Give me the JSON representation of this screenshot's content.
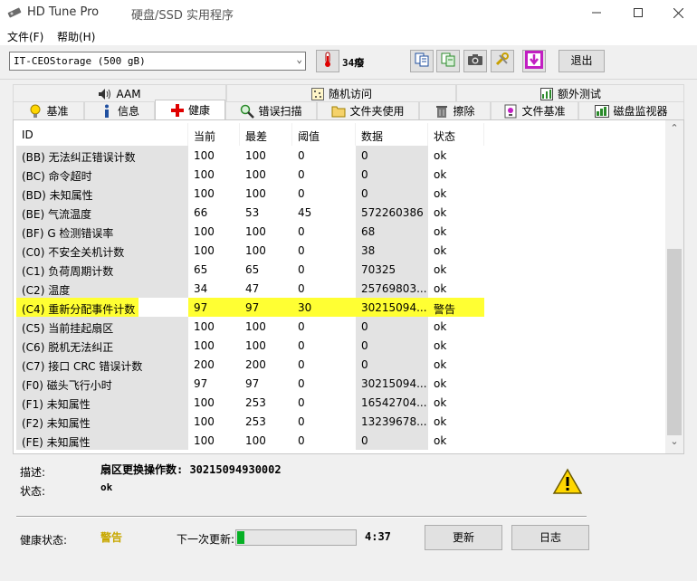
{
  "window": {
    "app_name": "HD Tune Pro",
    "subtitle": "硬盘/SSD 实用程序"
  },
  "menu": {
    "file": "文件(F)",
    "help": "帮助(H)"
  },
  "toolbar": {
    "drive": "IT-CEOStorage (500 gB)",
    "temperature": "34癈",
    "exit": "退出"
  },
  "tabs_row1": [
    {
      "label": "AAM",
      "icon": "speaker-icon"
    },
    {
      "label": "随机访问",
      "icon": "grid-icon"
    },
    {
      "label": "额外测试",
      "icon": "chart-icon"
    }
  ],
  "tabs_row2": [
    {
      "label": "基准",
      "icon": "bulb-icon"
    },
    {
      "label": "信息",
      "icon": "info-icon"
    },
    {
      "label": "健康",
      "icon": "health-cross-icon",
      "active": true
    },
    {
      "label": "错误扫描",
      "icon": "magnifier-icon"
    },
    {
      "label": "文件夹使用",
      "icon": "folder-icon"
    },
    {
      "label": "擦除",
      "icon": "trash-icon"
    },
    {
      "label": "文件基准",
      "icon": "file-bench-icon"
    },
    {
      "label": "磁盘监视器",
      "icon": "monitor-chart-icon"
    }
  ],
  "table": {
    "headers": [
      "ID",
      "当前",
      "最差",
      "阈值",
      "数据",
      "状态"
    ],
    "rows": [
      {
        "id": "(BB) 无法纠正错误计数",
        "current": "100",
        "worst": "100",
        "threshold": "0",
        "data": "0",
        "status": "ok"
      },
      {
        "id": "(BC) 命令超时",
        "current": "100",
        "worst": "100",
        "threshold": "0",
        "data": "0",
        "status": "ok"
      },
      {
        "id": "(BD) 未知属性",
        "current": "100",
        "worst": "100",
        "threshold": "0",
        "data": "0",
        "status": "ok"
      },
      {
        "id": "(BE) 气流温度",
        "current": "66",
        "worst": "53",
        "threshold": "45",
        "data": "572260386",
        "status": "ok"
      },
      {
        "id": "(BF) G 检测错误率",
        "current": "100",
        "worst": "100",
        "threshold": "0",
        "data": "68",
        "status": "ok"
      },
      {
        "id": "(C0) 不安全关机计数",
        "current": "100",
        "worst": "100",
        "threshold": "0",
        "data": "38",
        "status": "ok"
      },
      {
        "id": "(C1) 负荷周期计数",
        "current": "65",
        "worst": "65",
        "threshold": "0",
        "data": "70325",
        "status": "ok"
      },
      {
        "id": "(C2) 温度",
        "current": "34",
        "worst": "47",
        "threshold": "0",
        "data": "25769803...",
        "status": "ok"
      },
      {
        "id": "(C4) 重新分配事件计数",
        "current": "97",
        "worst": "97",
        "threshold": "30",
        "data": "30215094...",
        "status": "警告",
        "warning": true
      },
      {
        "id": "(C5) 当前挂起扇区",
        "current": "100",
        "worst": "100",
        "threshold": "0",
        "data": "0",
        "status": "ok"
      },
      {
        "id": "(C6) 脱机无法纠正",
        "current": "100",
        "worst": "100",
        "threshold": "0",
        "data": "0",
        "status": "ok"
      },
      {
        "id": "(C7) 接口 CRC 错误计数",
        "current": "200",
        "worst": "200",
        "threshold": "0",
        "data": "0",
        "status": "ok"
      },
      {
        "id": "(F0) 磁头飞行小时",
        "current": "97",
        "worst": "97",
        "threshold": "0",
        "data": "30215094...",
        "status": "ok"
      },
      {
        "id": "(F1) 未知属性",
        "current": "100",
        "worst": "253",
        "threshold": "0",
        "data": "16542704...",
        "status": "ok"
      },
      {
        "id": "(F2) 未知属性",
        "current": "100",
        "worst": "253",
        "threshold": "0",
        "data": "13239678...",
        "status": "ok"
      },
      {
        "id": "(FE) 未知属性",
        "current": "100",
        "worst": "100",
        "threshold": "0",
        "data": "0",
        "status": "ok"
      }
    ]
  },
  "details": {
    "description_label": "描述:",
    "description_value": "扇区更换操作数: 30215094930002",
    "status_label": "状态:",
    "status_value": "ok"
  },
  "footer": {
    "health_label": "健康状态:",
    "health_value": "警告",
    "next_update_label": "下一次更新:",
    "next_update_time": "4:37",
    "next_update_progress": 0.06,
    "refresh_button": "更新",
    "log_button": "日志"
  },
  "colors": {
    "warning_highlight": "#ffff33",
    "health_warning_text": "#c8a800",
    "progress_fill": "#06b025"
  }
}
